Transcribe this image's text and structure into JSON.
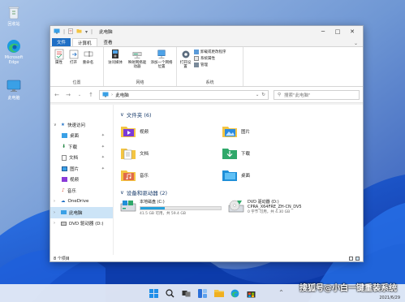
{
  "desktop": {
    "icons": [
      {
        "name": "recycle-bin-icon",
        "label": "回收站"
      },
      {
        "name": "edge-icon",
        "label": "Microsoft Edge"
      },
      {
        "name": "this-pc-icon",
        "label": "此电脑"
      }
    ]
  },
  "window": {
    "title": "此电脑",
    "tabs": [
      "文件",
      "计算机",
      "查看"
    ],
    "ribbon": {
      "groups": [
        {
          "label": "位置",
          "buttons": [
            "属性",
            "打开",
            "重命名"
          ]
        },
        {
          "label": "网络",
          "buttons": [
            "访问媒体",
            "映射网络驱动器",
            "添加一个网络位置"
          ]
        },
        {
          "label": "系统",
          "buttons": [
            "打开设置"
          ],
          "small": [
            "卸载或更改程序",
            "系统属性",
            "管理"
          ]
        }
      ]
    },
    "address": {
      "crumbs": [
        "此电脑"
      ],
      "search_placeholder": "搜索\"此电脑\""
    },
    "nav_pane": {
      "items": [
        {
          "label": "快速访问",
          "level": 0,
          "chevron": "v"
        },
        {
          "label": "桌面",
          "level": 1,
          "pinned": true
        },
        {
          "label": "下载",
          "level": 1,
          "pinned": true
        },
        {
          "label": "文档",
          "level": 1,
          "pinned": true
        },
        {
          "label": "图片",
          "level": 1,
          "pinned": true
        },
        {
          "label": "视频",
          "level": 1
        },
        {
          "label": "音乐",
          "level": 1
        },
        {
          "label": "OneDrive",
          "level": 0,
          "chevron": ">"
        },
        {
          "label": "此电脑",
          "level": 0,
          "chevron": ">",
          "selected": true
        },
        {
          "label": "DVD 驱动器 (D:)",
          "level": 0,
          "chevron": ">"
        }
      ]
    },
    "folders_header": "文件夹 (6)",
    "folders": [
      {
        "label": "视频",
        "icon": "video-folder-icon"
      },
      {
        "label": "图片",
        "icon": "pictures-folder-icon"
      },
      {
        "label": "文档",
        "icon": "documents-folder-icon"
      },
      {
        "label": "下载",
        "icon": "downloads-folder-icon"
      },
      {
        "label": "音乐",
        "icon": "music-folder-icon"
      },
      {
        "label": "桌面",
        "icon": "desktop-folder-icon"
      }
    ],
    "drives_header": "设备和驱动器 (2)",
    "drives": [
      {
        "label": "本地磁盘 (C:)",
        "free": "41.5 GB 可用，共 59.4 GB",
        "used_fraction": 0.3,
        "icon": "local-disk-icon"
      },
      {
        "label": "DVD 驱动器 (D:)",
        "sub": "CPRA_X64FRE_ZH-CN_DV5",
        "free": "0 字节 可用，共 4.30 GB",
        "icon": "dvd-drive-icon"
      }
    ],
    "status": "8 个项目"
  },
  "taskbar": {
    "icons": [
      "start-icon",
      "search-icon",
      "task-view-icon",
      "widgets-icon",
      "explorer-icon",
      "edge-icon",
      "store-icon"
    ],
    "watermark": "搜狐号@小白一键重装系统",
    "date": "2021/6/29"
  },
  "colors": {
    "accent": "#1f6fc5",
    "selection": "#cce4f7",
    "drive_fill": "#26a0da"
  }
}
